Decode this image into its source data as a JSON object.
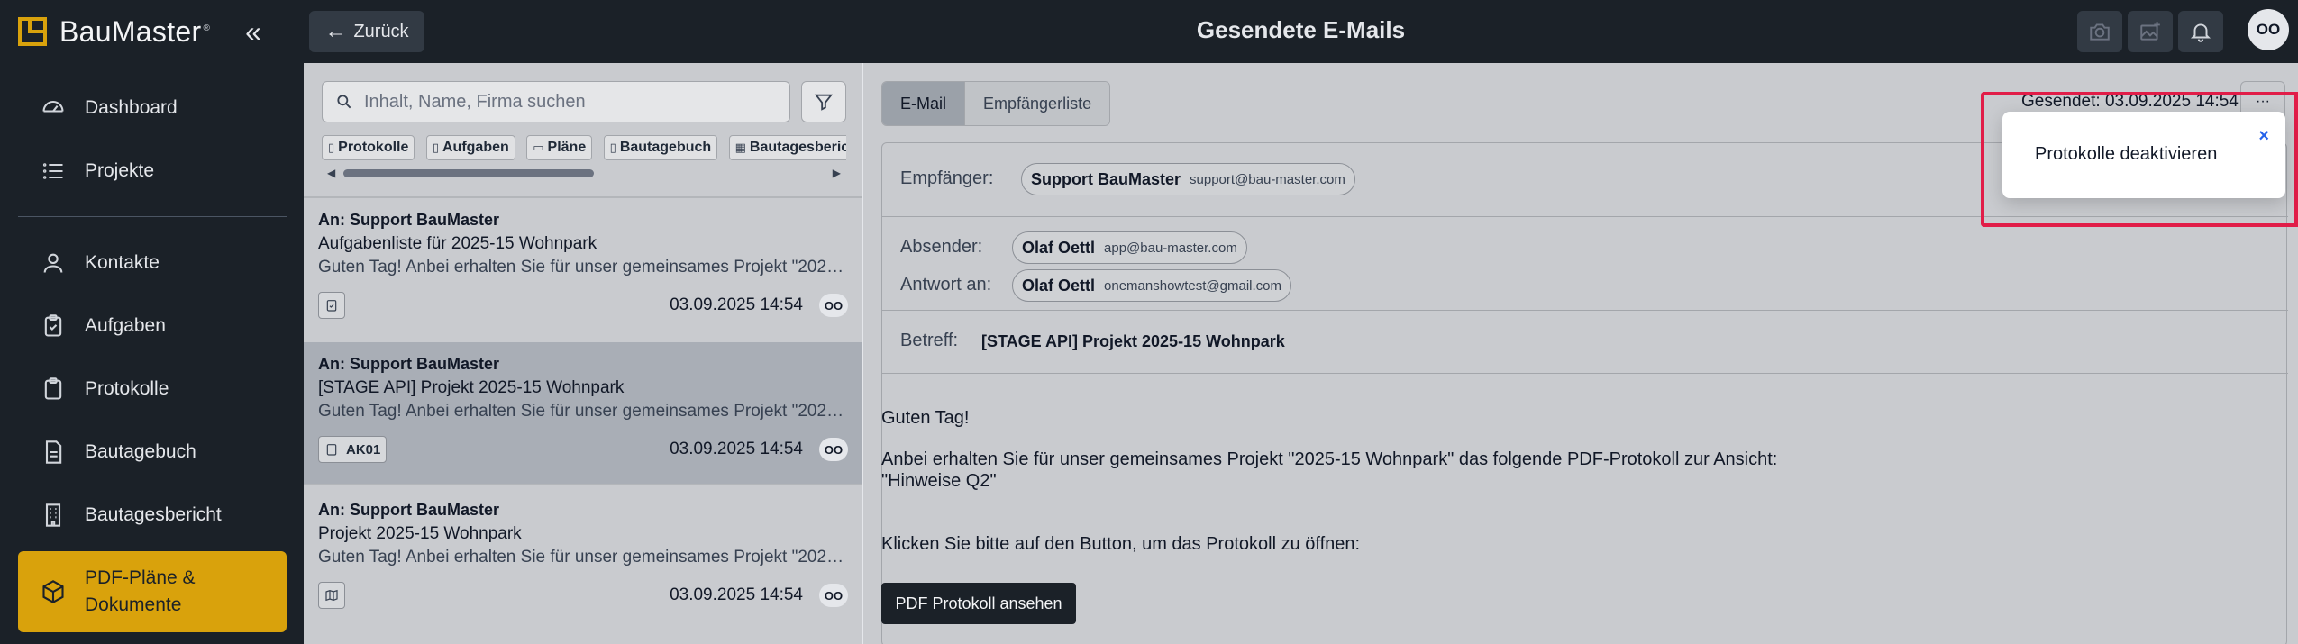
{
  "app": {
    "brand": "BauMaster",
    "brand_mark": "®",
    "collapse_glyph": "«"
  },
  "sidebar": {
    "items": [
      {
        "label": "Dashboard",
        "icon": "gauge-icon"
      },
      {
        "label": "Projekte",
        "icon": "list-icon"
      },
      {
        "label": "Kontakte",
        "icon": "user-icon"
      },
      {
        "label": "Aufgaben",
        "icon": "clipboard-check-icon"
      },
      {
        "label": "Protokolle",
        "icon": "clipboard-icon"
      },
      {
        "label": "Bautagebuch",
        "icon": "document-icon"
      },
      {
        "label": "Bautagesbericht",
        "icon": "building-icon"
      },
      {
        "label": "PDF-Pläne & Dokumente",
        "icon": "cube-icon",
        "active": true
      }
    ]
  },
  "topbar": {
    "back_label": "Zurück",
    "title": "Gesendete E-Mails",
    "avatar_initials": "OO"
  },
  "list": {
    "search_placeholder": "Inhalt, Name, Firma suchen",
    "chips": [
      {
        "label": "Protokolle",
        "glyph": "▯"
      },
      {
        "label": "Aufgaben",
        "glyph": "▯"
      },
      {
        "label": "Pläne",
        "glyph": "▭"
      },
      {
        "label": "Bautagebuch",
        "glyph": "▯"
      },
      {
        "label": "Bautagesberic",
        "glyph": "▦"
      }
    ],
    "mails": [
      {
        "to": "An: Support BauMaster",
        "subject": "Aufgabenliste für 2025-15 Wohnpark",
        "preview": "Guten Tag! Anbei erhalten Sie für unser gemeinsames Projekt \"2025-...",
        "tag": "",
        "date": "03.09.2025 14:54",
        "avatar": "OO"
      },
      {
        "to": "An: Support BauMaster",
        "subject": "[STAGE API] Projekt 2025-15 Wohnpark",
        "preview": "Guten Tag! Anbei erhalten Sie für unser gemeinsames Projekt \"2025-...",
        "tag": "AK01",
        "date": "03.09.2025 14:54",
        "avatar": "OO",
        "selected": true
      },
      {
        "to": "An: Support BauMaster",
        "subject": "Projekt 2025-15 Wohnpark",
        "preview": "Guten Tag! Anbei erhalten Sie für unser gemeinsames Projekt \"2025-...",
        "tag": "",
        "date": "03.09.2025 14:54",
        "avatar": "OO"
      }
    ]
  },
  "detail": {
    "tabs": [
      "E-Mail",
      "Empfängerliste"
    ],
    "sent": "Gesendet: 03.09.2025 14:54",
    "more_glyph": "···",
    "recipient_label": "Empfänger:",
    "recipient": {
      "name": "Support BauMaster",
      "email": "support@bau-master.com"
    },
    "sender_label": "Absender:",
    "sender": {
      "name": "Olaf Oettl",
      "email": "app@bau-master.com"
    },
    "reply_label": "Antwort an:",
    "reply": {
      "name": "Olaf Oettl",
      "email": "onemanshowtest@gmail.com"
    },
    "subject_label": "Betreff:",
    "subject": "[STAGE API] Projekt 2025-15 Wohnpark",
    "body": {
      "greeting": "Guten Tag!",
      "line1": "Anbei erhalten Sie für unser gemeinsames Projekt \"2025-15 Wohnpark\" das folgende PDF-Protokoll zur Ansicht:",
      "line2": "\"Hinweise Q2\"",
      "line3": "Klicken Sie bitte auf den Button, um das Protokoll zu öffnen:"
    },
    "pdf_button": "PDF Protokoll ansehen"
  },
  "popover": {
    "text": "Protokolle deaktivieren",
    "close_glyph": "×"
  },
  "colors": {
    "sidebar_bg": "#1b2128",
    "accent": "#d9a20c",
    "highlight": "#e11d48",
    "close": "#2563eb"
  }
}
